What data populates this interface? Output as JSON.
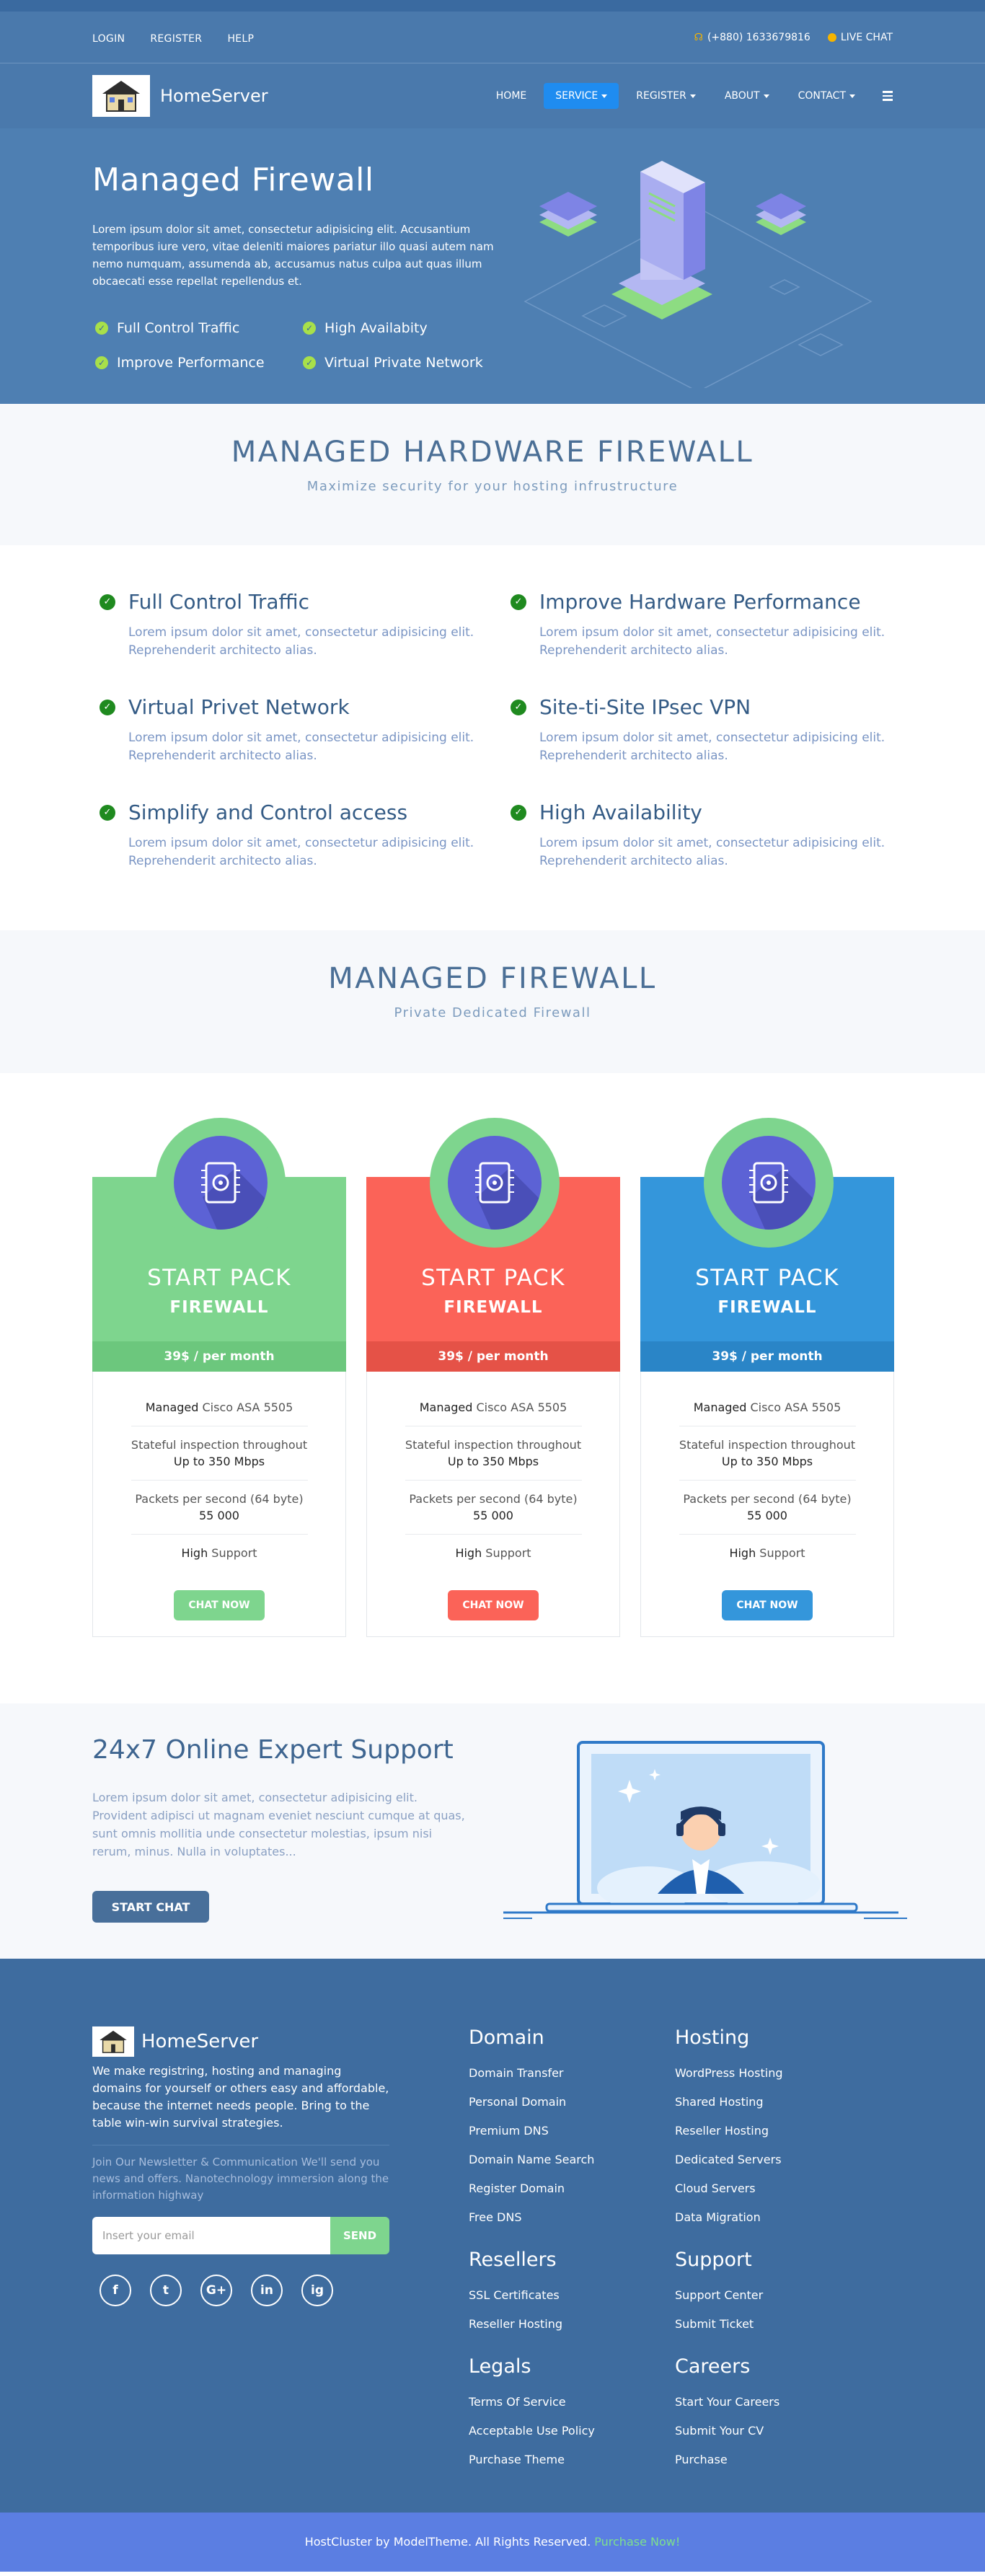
{
  "topbar": {
    "links": [
      "LOGIN",
      "REGISTER",
      "HELP"
    ],
    "phone": "(+880) 1633679816",
    "live_chat": "LIVE CHAT"
  },
  "nav": {
    "brand": "HomeServer",
    "items": [
      {
        "label": "HOME",
        "dropdown": false,
        "active": false
      },
      {
        "label": "SERVICE",
        "dropdown": true,
        "active": true
      },
      {
        "label": "REGISTER",
        "dropdown": true,
        "active": false
      },
      {
        "label": "ABOUT",
        "dropdown": true,
        "active": false
      },
      {
        "label": "CONTACT",
        "dropdown": true,
        "active": false
      }
    ]
  },
  "hero": {
    "title": "Managed Firewall",
    "text": "Lorem ipsum dolor sit amet, consectetur adipisicing elit. Accusantium temporibus iure vero, vitae deleniti maiores pariatur illo quasi autem nam nemo numquam, assumenda ab, accusamus natus culpa aut quas illum obcaecati esse repellat repellendus et.",
    "features": [
      "Full Control Traffic",
      "High Availabity",
      "Improve Performance",
      "Virtual Private Network"
    ]
  },
  "section1": {
    "title": "MANAGED HARDWARE FIREWALL",
    "subtitle": "Maximize security for your hosting infrustructure"
  },
  "features": [
    {
      "title": "Full Control Traffic",
      "desc": "Lorem ipsum dolor sit amet, consectetur adipisicing elit. Reprehenderit architecto alias."
    },
    {
      "title": "Improve Hardware Performance",
      "desc": "Lorem ipsum dolor sit amet, consectetur adipisicing elit. Reprehenderit architecto alias."
    },
    {
      "title": "Virtual Privet Network",
      "desc": "Lorem ipsum dolor sit amet, consectetur adipisicing elit. Reprehenderit architecto alias."
    },
    {
      "title": "Site-ti-Site IPsec VPN",
      "desc": "Lorem ipsum dolor sit amet, consectetur adipisicing elit. Reprehenderit architecto alias."
    },
    {
      "title": "Simplify and Control access",
      "desc": "Lorem ipsum dolor sit amet, consectetur adipisicing elit. Reprehenderit architecto alias."
    },
    {
      "title": "High Availability",
      "desc": "Lorem ipsum dolor sit amet, consectetur adipisicing elit. Reprehenderit architecto alias."
    }
  ],
  "section2": {
    "title": "MANAGED FIREWALL",
    "subtitle": "Private Dedicated Firewall"
  },
  "plans": [
    {
      "name": "START PACK",
      "sub": "FIREWALL",
      "price": "39$ / per month",
      "color": "#7ed58e",
      "price_bg": "#6cc77d",
      "btn_color": "#7ed58e",
      "rows": [
        [
          "Managed",
          " Cisco ASA 5505"
        ],
        [
          "Stateful inspection throughout",
          "Up to 350 Mbps"
        ],
        [
          "Packets per second (64 byte)",
          "55 000"
        ],
        [
          "High",
          " Support"
        ]
      ],
      "button": "CHAT NOW"
    },
    {
      "name": "START PACK",
      "sub": "FIREWALL",
      "price": "39$ / per month",
      "color": "#fb6358",
      "price_bg": "#e55247",
      "btn_color": "#fb6358",
      "rows": [
        [
          "Managed",
          " Cisco ASA 5505"
        ],
        [
          "Stateful inspection throughout",
          "Up to 350 Mbps"
        ],
        [
          "Packets per second (64 byte)",
          "55 000"
        ],
        [
          "High",
          " Support"
        ]
      ],
      "button": "CHAT NOW"
    },
    {
      "name": "START PACK",
      "sub": "FIREWALL",
      "price": "39$ / per month",
      "color": "#3496db",
      "price_bg": "#2a85c7",
      "btn_color": "#3496db",
      "rows": [
        [
          "Managed",
          " Cisco ASA 5505"
        ],
        [
          "Stateful inspection throughout",
          "Up to 350 Mbps"
        ],
        [
          "Packets per second (64 byte)",
          "55 000"
        ],
        [
          "High",
          " Support"
        ]
      ],
      "button": "CHAT NOW"
    }
  ],
  "support": {
    "title": "24x7 Online Expert Support",
    "text": "Lorem ipsum dolor sit amet, consectetur adipisicing elit. Provident adipisci ut magnam eveniet nesciunt cumque at quas, sunt omnis mollitia unde consectetur molestias, ipsum nisi rerum, minus. Nulla in voluptates...",
    "button": "START CHAT"
  },
  "footer": {
    "brand": "HomeServer",
    "desc": "We make registring, hosting and managing domains for yourself or others easy and affordable, because the internet needs people. Bring to the table win-win survival strategies.",
    "newsletter": "Join Our Newsletter & Communication We'll send you news and offers. Nanotechnology immersion along the information highway",
    "email_placeholder": "Insert your email",
    "send": "SEND",
    "social": [
      "f",
      "t",
      "G+",
      "in",
      "ig"
    ],
    "columns": [
      {
        "title": "Domain",
        "links": [
          "Domain Transfer",
          "Personal Domain",
          "Premium DNS",
          "Domain Name Search",
          "Register Domain",
          "Free DNS"
        ]
      },
      {
        "title": "Hosting",
        "links": [
          "WordPress Hosting",
          "Shared Hosting",
          "Reseller Hosting",
          "Dedicated Servers",
          "Cloud Servers",
          "Data Migration"
        ]
      },
      {
        "title": "Resellers",
        "links": [
          "SSL Certificates",
          "Reseller Hosting"
        ]
      },
      {
        "title": "Support",
        "links": [
          "Support Center",
          "Submit Ticket"
        ]
      },
      {
        "title": "Legals",
        "links": [
          "Terms Of Service",
          "Acceptable Use Policy",
          "Purchase Theme"
        ]
      },
      {
        "title": "Careers",
        "links": [
          "Start Your Careers",
          "Submit Your CV",
          "Purchase"
        ]
      }
    ],
    "copyright": "HostCluster by ModelTheme. All Rights Reserved.",
    "purchase": "Purchase Now!"
  }
}
